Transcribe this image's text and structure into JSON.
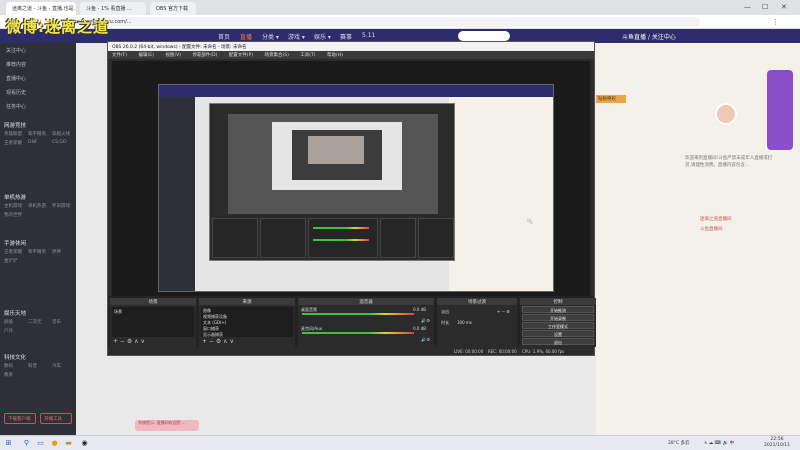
{
  "watermark": "微博:迷离之道",
  "browser": {
    "tabs": [
      "迷离之道 - 斗鱼 - 直播,也是...",
      "斗鱼 - 1% 看直播 ...",
      "OBS 官方下载"
    ],
    "url": "https://www.douyu.com/...",
    "window_controls": [
      "—",
      "☐",
      "✕"
    ]
  },
  "site": {
    "nav": [
      "首页",
      "直播",
      "分类 ▾",
      "游戏 ▾",
      "娱乐 ▾",
      "赛事",
      "5.11"
    ],
    "active_nav_index": 1,
    "user_text": "斗鱼直播 / 关注中心"
  },
  "sidebar": {
    "items": [
      "关注中心",
      "推荐内容",
      "直播中心",
      "观看历史",
      "任务中心"
    ],
    "sections": [
      {
        "title": "网游竞技",
        "subs": [
          "英雄联盟",
          "和平精英",
          "穿越火线",
          "王者荣耀",
          "DNF",
          "CS:GO"
        ]
      },
      {
        "title": "单机热游",
        "subs": [
          "主机游戏",
          "单机热游",
          "怀旧游戏",
          "我的世界"
        ]
      },
      {
        "title": "手游休闲",
        "subs": [
          "王者荣耀",
          "和平精英",
          "原神",
          "金铲铲"
        ]
      },
      {
        "title": "娱乐天地",
        "subs": [
          "颜值",
          "二次元",
          "音乐",
          "户外"
        ]
      },
      {
        "title": "科技文化",
        "subs": [
          "数码",
          "科普",
          "汽车",
          "教育"
        ]
      }
    ],
    "buttons": [
      "下载客户端",
      "开播工具"
    ]
  },
  "right_panel": {
    "tag": "钻粉特权",
    "description": "欢迎来到直播间!斗鱼严禁未成年人直播或打赏,请理性消费。直播内容包含...",
    "links": [
      "迷离之道直播间",
      "斗鱼直播间"
    ]
  },
  "bottom_pill": "系统提示: 直播间欢迎您 ...",
  "obs": {
    "title": "OBS 26.0.2 (64-bit, windows) - 配置文件: 未命名 - 场景: 未命名",
    "menu": [
      "文件(F)",
      "编辑(E)",
      "视图(V)",
      "停靠部件(D)",
      "配置文件(P)",
      "场景集合(S)",
      "工具(T)",
      "帮助(H)"
    ],
    "docks": {
      "scenes": {
        "title": "场景",
        "items": [
          "场景"
        ]
      },
      "sources": {
        "title": "来源",
        "items": [
          "图像",
          "视频捕获设备",
          "文本 (GDI+)",
          "窗口捕获",
          "显示器捕获"
        ]
      },
      "mixer": {
        "title": "混音器",
        "channels": [
          {
            "name": "桌面音频",
            "db": "0.0 dB",
            "level": 0.8
          },
          {
            "name": "麦克风/Aux",
            "db": "0.0 dB",
            "level": 0.6
          }
        ]
      },
      "transitions": {
        "title": "场景过渡",
        "type": "淡出",
        "duration_label": "时长",
        "duration": "300 ms"
      },
      "controls": {
        "title": "控制",
        "buttons": [
          "开始推流",
          "开始录制",
          "工作室模式",
          "设置",
          "退出"
        ]
      }
    },
    "status": {
      "live": "LIVE: 00:00:00",
      "rec": "REC: 00:00:00",
      "cpu": "CPU: 1.9%, 60.00 fps"
    }
  },
  "taskbar": {
    "weather": "28°C 多云",
    "tray": "∧ ☁ ⌨ 🔊 中",
    "time": "22:56",
    "date": "2021/10/11"
  }
}
